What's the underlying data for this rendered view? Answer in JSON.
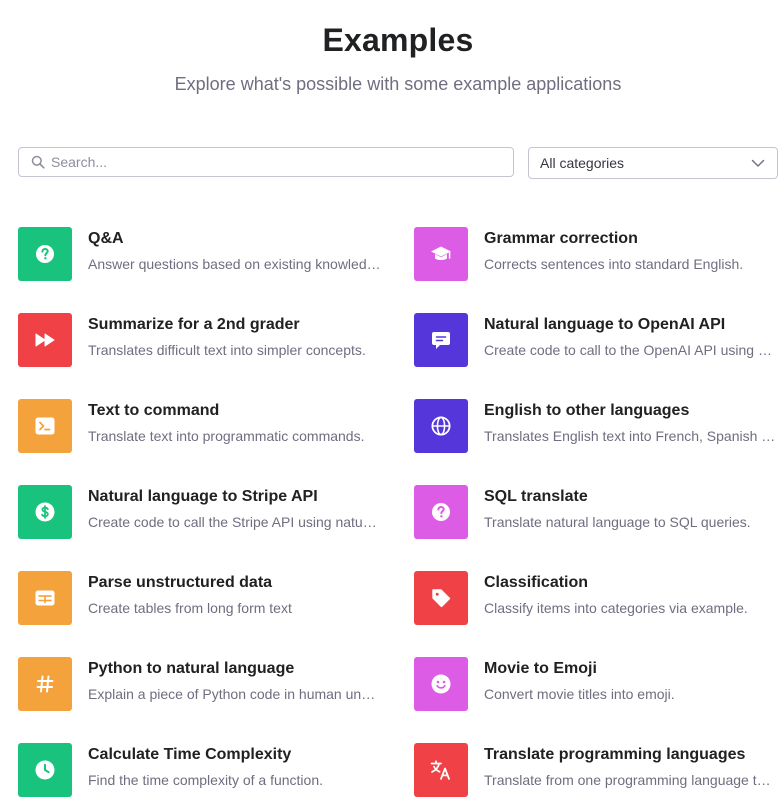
{
  "header": {
    "title": "Examples",
    "subtitle": "Explore what's possible with some example applications"
  },
  "search": {
    "placeholder": "Search...",
    "value": ""
  },
  "category_filter": {
    "selected": "All categories"
  },
  "colors": {
    "green": "#19c37d",
    "red": "#ef4146",
    "orange": "#f4a23b",
    "purple": "#5436da",
    "magenta": "#dd5ce5"
  },
  "examples": [
    {
      "name": "Q&A",
      "description": "Answer questions based on existing knowledge.",
      "icon": "question-circle-icon",
      "color": "#19c37d"
    },
    {
      "name": "Grammar correction",
      "description": "Corrects sentences into standard English.",
      "icon": "graduation-cap-icon",
      "color": "#dd5ce5"
    },
    {
      "name": "Summarize for a 2nd grader",
      "description": "Translates difficult text into simpler concepts.",
      "icon": "fast-forward-icon",
      "color": "#ef4146"
    },
    {
      "name": "Natural language to OpenAI API",
      "description": "Create code to call to the OpenAI API using a natural language instruction.",
      "icon": "chat-bubble-icon",
      "color": "#5436da"
    },
    {
      "name": "Text to command",
      "description": "Translate text into programmatic commands.",
      "icon": "terminal-icon",
      "color": "#f4a23b"
    },
    {
      "name": "English to other languages",
      "description": "Translates English text into French, Spanish and Japanese.",
      "icon": "globe-icon",
      "color": "#5436da"
    },
    {
      "name": "Natural language to Stripe API",
      "description": "Create code to call the Stripe API using natural language.",
      "icon": "dollar-circle-icon",
      "color": "#19c37d"
    },
    {
      "name": "SQL translate",
      "description": "Translate natural language to SQL queries.",
      "icon": "question-circle-icon",
      "color": "#dd5ce5"
    },
    {
      "name": "Parse unstructured data",
      "description": "Create tables from long form text",
      "icon": "table-icon",
      "color": "#f4a23b"
    },
    {
      "name": "Classification",
      "description": "Classify items into categories via example.",
      "icon": "tag-icon",
      "color": "#ef4146"
    },
    {
      "name": "Python to natural language",
      "description": "Explain a piece of Python code in human understandable language.",
      "icon": "hashtag-icon",
      "color": "#f4a23b"
    },
    {
      "name": "Movie to Emoji",
      "description": "Convert movie titles into emoji.",
      "icon": "smiley-icon",
      "color": "#dd5ce5"
    },
    {
      "name": "Calculate Time Complexity",
      "description": "Find the time complexity of a function.",
      "icon": "clock-icon",
      "color": "#19c37d"
    },
    {
      "name": "Translate programming languages",
      "description": "Translate from one programming language to another.",
      "icon": "translate-icon",
      "color": "#ef4146"
    }
  ]
}
